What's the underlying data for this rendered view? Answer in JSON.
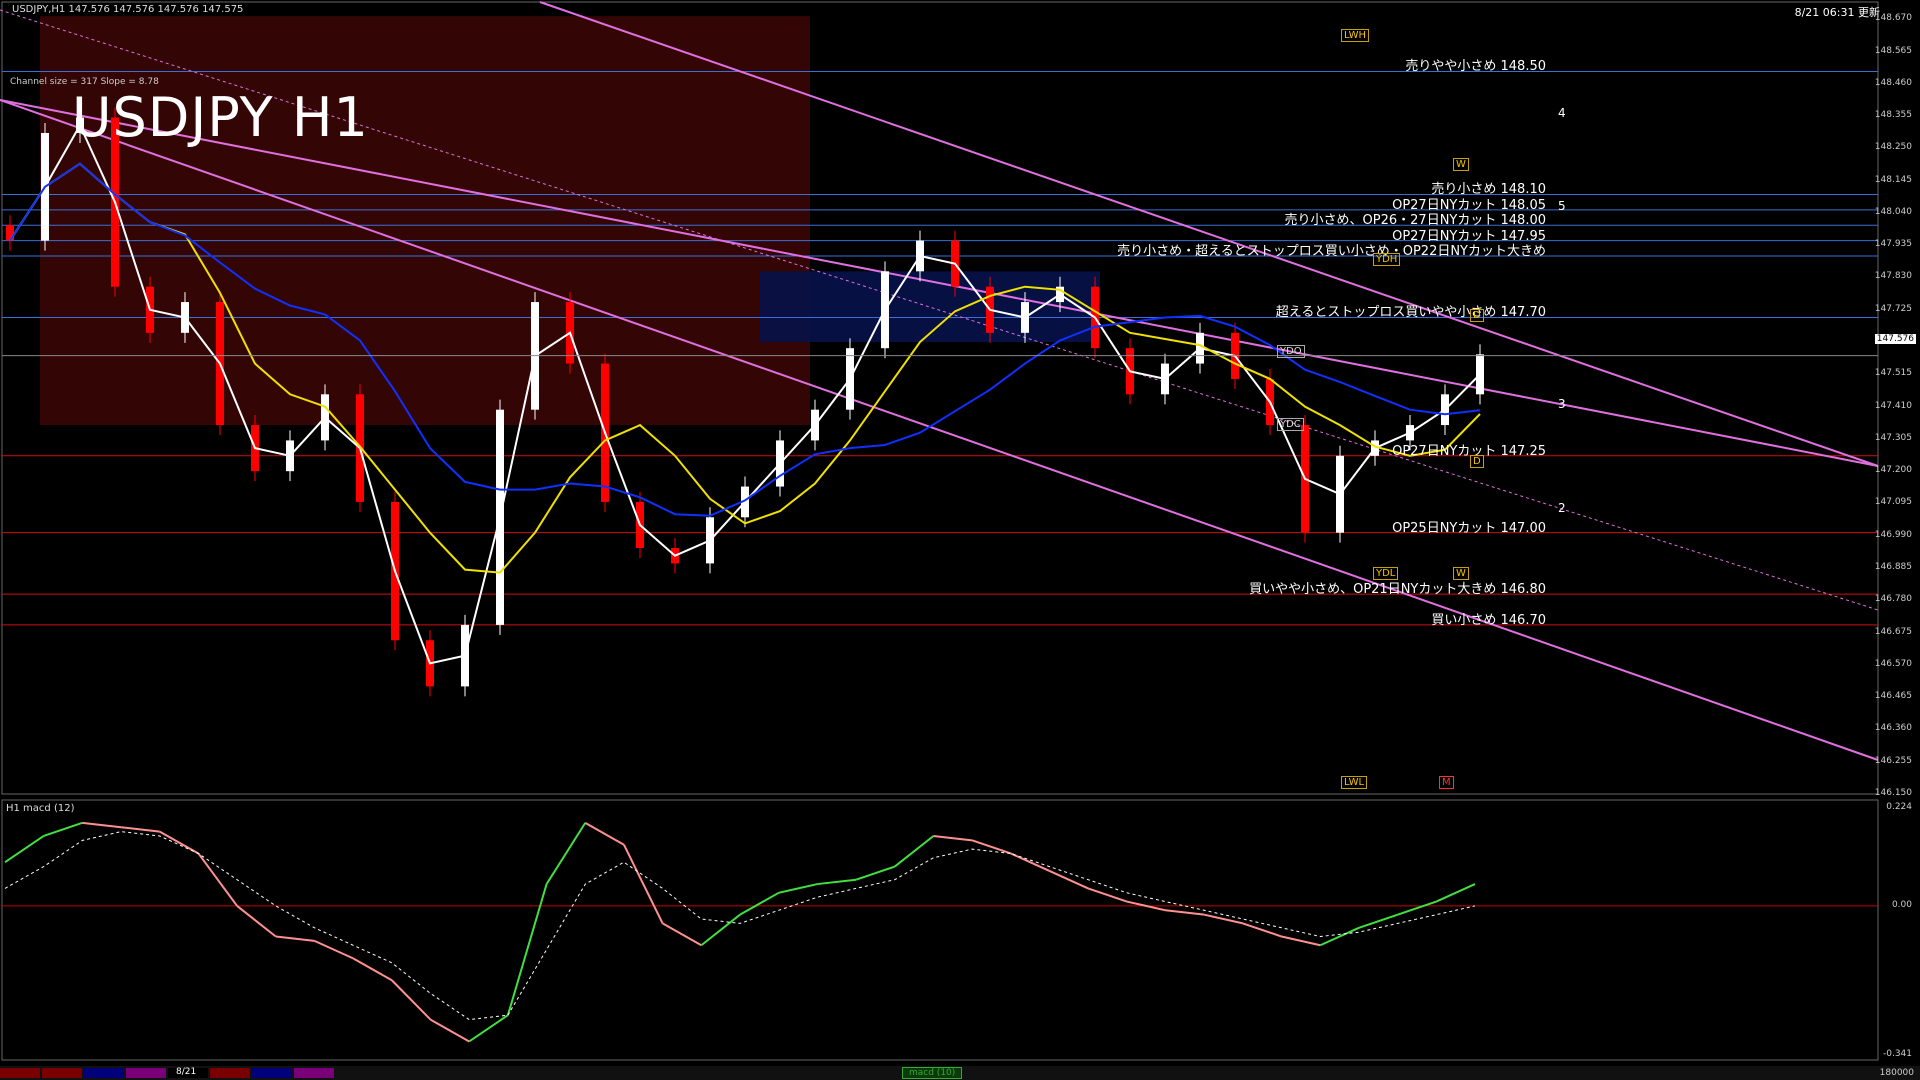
{
  "header": {
    "symbol_info": "USDJPY,H1  147.576 147.576 147.576 147.575",
    "clock": "8/21 06:31 更新",
    "title": "USDJPY H1",
    "channel_info": "Channel size = 317  Slope = 8.78"
  },
  "macd_label": "H1  macd (12)",
  "footer": {
    "date_tab": "8/21",
    "macd_tab": "macd (10)",
    "volume": "180000",
    "tab_colors": [
      "#7a0000",
      "#7a0000",
      "#00007a",
      "#7a007a",
      "#000000",
      "#7a0000",
      "#00007a",
      "#7a007a"
    ]
  },
  "colors": {
    "bg": "#000000",
    "resistance": "#3a6fd8",
    "support": "#d01010",
    "channel": "#e070e0",
    "bull": "#ffffff",
    "bear": "#ff0000",
    "ma_fast": "#ffffff",
    "ma_mid": "#f0e000",
    "ma_slow": "#1030ff",
    "macd_up": "#40e040",
    "macd_down": "#ff9090",
    "signal": "#ffffff"
  },
  "chart_data": {
    "type": "line",
    "title": "USDJPY H1",
    "price_axis": {
      "ylim": [
        146.15,
        148.7
      ],
      "ticks": [
        "148.670",
        "148.565",
        "148.460",
        "148.355",
        "148.250",
        "148.145",
        "148.040",
        "147.935",
        "147.830",
        "147.725",
        "147.620",
        "147.515",
        "147.410",
        "147.305",
        "147.200",
        "147.095",
        "146.990",
        "146.885",
        "146.780",
        "146.675",
        "146.570",
        "146.465",
        "146.360",
        "146.255",
        "146.150"
      ],
      "current_price": "147.576"
    },
    "macd_axis": {
      "ylim": [
        -0.341,
        0.224
      ],
      "ticks": [
        "0.224",
        "0.00",
        "-0.341"
      ]
    },
    "levels": [
      {
        "price": 148.5,
        "label": "売りやや小さめ 148.50",
        "side": "sell"
      },
      {
        "price": 148.1,
        "label": "売り小さめ 148.10",
        "side": "sell"
      },
      {
        "price": 148.05,
        "label": "OP27日NYカット 148.05",
        "side": "sell"
      },
      {
        "price": 148.0,
        "label": "売り小さめ、OP26・27日NYカット 148.00",
        "side": "sell"
      },
      {
        "price": 147.95,
        "label": "OP27日NYカット 147.95",
        "side": "sell"
      },
      {
        "price": 147.9,
        "label": "売り小さめ・超えるとストップロス買い小さめ・OP22日NYカット大きめ",
        "side": "sell"
      },
      {
        "price": 147.7,
        "label": "超えるとストップロス買いやや小さめ 147.70",
        "side": "sell"
      },
      {
        "price": 147.25,
        "label": "OP27日NYカット 147.25",
        "side": "buy"
      },
      {
        "price": 147.0,
        "label": "OP25日NYカット 147.00",
        "side": "buy"
      },
      {
        "price": 146.8,
        "label": "買いやや小さめ、OP21日NYカット大きめ 146.80",
        "side": "buy"
      },
      {
        "price": 146.7,
        "label": "買い小さめ 146.70",
        "side": "buy"
      }
    ],
    "wave_labels": [
      "4",
      "5",
      "3",
      "2"
    ],
    "box_labels": [
      "LWH",
      "YDH",
      "YDO",
      "YDC",
      "YDL",
      "LWL",
      "D",
      "W",
      "M"
    ],
    "price_series": [
      147.95,
      148.3,
      148.35,
      147.8,
      147.65,
      147.75,
      147.35,
      147.2,
      147.3,
      147.45,
      147.1,
      146.65,
      146.5,
      146.7,
      147.4,
      147.75,
      147.55,
      147.1,
      146.95,
      146.9,
      147.05,
      147.15,
      147.3,
      147.4,
      147.6,
      147.85,
      147.95,
      147.8,
      147.65,
      147.75,
      147.8,
      147.6,
      147.45,
      147.55,
      147.65,
      147.5,
      147.35,
      147.0,
      147.25,
      147.3,
      147.35,
      147.45,
      147.58
    ],
    "macd_series": [
      0.1,
      0.16,
      0.19,
      0.18,
      0.17,
      0.12,
      0.0,
      -0.07,
      -0.08,
      -0.12,
      -0.17,
      -0.26,
      -0.31,
      -0.25,
      0.05,
      0.19,
      0.14,
      -0.04,
      -0.09,
      -0.02,
      0.03,
      0.05,
      0.06,
      0.09,
      0.16,
      0.15,
      0.12,
      0.08,
      0.04,
      0.01,
      -0.01,
      -0.02,
      -0.04,
      -0.07,
      -0.09,
      -0.05,
      -0.02,
      0.01,
      0.05
    ],
    "signal_series": [
      0.04,
      0.09,
      0.15,
      0.17,
      0.16,
      0.12,
      0.06,
      0.0,
      -0.05,
      -0.09,
      -0.13,
      -0.2,
      -0.26,
      -0.25,
      -0.1,
      0.05,
      0.1,
      0.04,
      -0.03,
      -0.04,
      -0.01,
      0.02,
      0.04,
      0.06,
      0.11,
      0.13,
      0.12,
      0.09,
      0.06,
      0.03,
      0.01,
      -0.01,
      -0.03,
      -0.05,
      -0.07,
      -0.06,
      -0.04,
      -0.02,
      0.0
    ]
  }
}
